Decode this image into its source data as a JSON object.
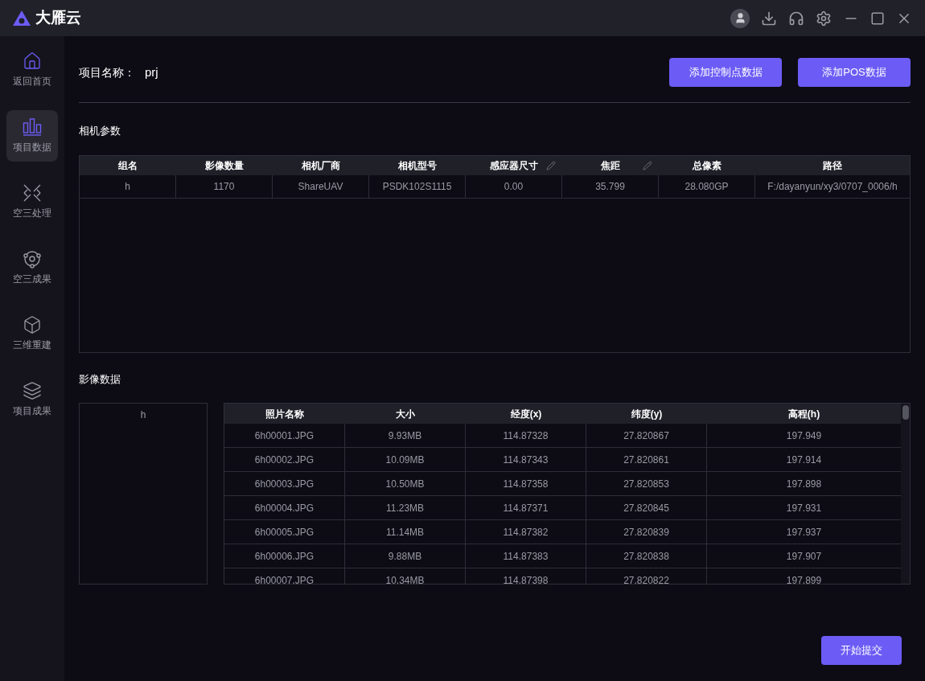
{
  "app": {
    "title": "大雁云"
  },
  "sidebar": {
    "items": [
      {
        "label": "返回首页",
        "selected": false
      },
      {
        "label": "项目数据",
        "selected": true
      },
      {
        "label": "空三处理",
        "selected": false
      },
      {
        "label": "空三成果",
        "selected": false
      },
      {
        "label": "三维重建",
        "selected": false
      },
      {
        "label": "项目成果",
        "selected": false
      }
    ]
  },
  "project": {
    "label": "项目名称：",
    "value": "prj"
  },
  "actions": [
    "添加控制点数据",
    "添加POS数据"
  ],
  "camera_section": {
    "title": "相机参数",
    "columns": [
      {
        "label": "组名",
        "editable": false
      },
      {
        "label": "影像数量",
        "editable": false
      },
      {
        "label": "相机厂商",
        "editable": false
      },
      {
        "label": "相机型号",
        "editable": false
      },
      {
        "label": "感应器尺寸",
        "editable": true
      },
      {
        "label": "焦距",
        "editable": true
      },
      {
        "label": "总像素",
        "editable": false
      },
      {
        "label": "路径",
        "editable": false
      }
    ],
    "rows": [
      [
        "h",
        "1170",
        "ShareUAV",
        "PSDK102S1115",
        "0.00",
        "35.799",
        "28.080GP",
        "F:/dayanyun/xy3/0707_0006/h"
      ]
    ]
  },
  "image_section": {
    "title": "影像数据",
    "groups": [
      "h"
    ],
    "columns": [
      "照片名称",
      "大小",
      "经度(x)",
      "纬度(y)",
      "高程(h)"
    ],
    "rows": [
      [
        "6h00001.JPG",
        "9.93MB",
        "114.87328",
        "27.820867",
        "197.949"
      ],
      [
        "6h00002.JPG",
        "10.09MB",
        "114.87343",
        "27.820861",
        "197.914"
      ],
      [
        "6h00003.JPG",
        "10.50MB",
        "114.87358",
        "27.820853",
        "197.898"
      ],
      [
        "6h00004.JPG",
        "11.23MB",
        "114.87371",
        "27.820845",
        "197.931"
      ],
      [
        "6h00005.JPG",
        "11.14MB",
        "114.87382",
        "27.820839",
        "197.937"
      ],
      [
        "6h00006.JPG",
        "9.88MB",
        "114.87383",
        "27.820838",
        "197.907"
      ],
      [
        "6h00007.JPG",
        "10.34MB",
        "114.87398",
        "27.820822",
        "197.899"
      ]
    ]
  },
  "submit": "开始提交"
}
